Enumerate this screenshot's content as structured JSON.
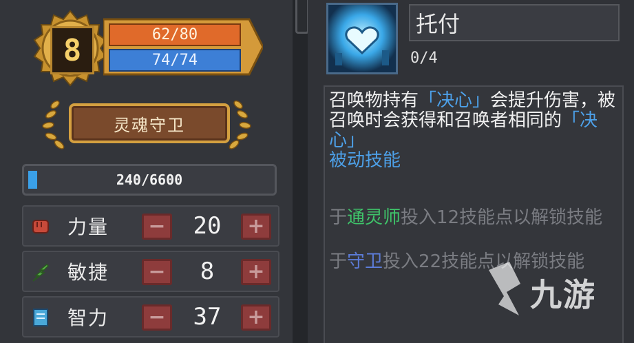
{
  "character": {
    "level": "8",
    "hp": "62/80",
    "mp": "74/74",
    "title": "灵魂守卫",
    "xp": "240/6600",
    "xp_progress": 0.036
  },
  "stats": [
    {
      "label": "力量",
      "value": "20",
      "icon": "fist-icon",
      "color": "#c84a3a"
    },
    {
      "label": "敏捷",
      "value": "8",
      "icon": "feather-icon",
      "color": "#5ab04a"
    },
    {
      "label": "智力",
      "value": "37",
      "icon": "book-icon",
      "color": "#4aa8d8"
    }
  ],
  "skill": {
    "name": "托付",
    "level": "0/4",
    "icon": "heart-spirit-icon",
    "desc_part1": "召唤物持有",
    "desc_hl1": "「决心」",
    "desc_part2": "会提升伤害，被召唤时会获得和召唤者相同的",
    "desc_hl2": "「决心」",
    "type": "被动技能",
    "unlock1_pre": "于",
    "unlock1_class": "通灵师",
    "unlock1_post": "投入12技能点以解锁技能",
    "unlock2_pre": "于",
    "unlock2_class": "守卫",
    "unlock2_post": "投入22技能点以解锁技能"
  },
  "watermark": {
    "text": "九游",
    "icon": "jiuyou-logo-icon"
  },
  "colors": {
    "hp": "#e06a2a",
    "mp": "#3d7fd6",
    "gold": "#d4a040",
    "accent_blue": "#4da0e8",
    "class_green": "#3fc46a",
    "class_blue": "#5c7cd8"
  }
}
